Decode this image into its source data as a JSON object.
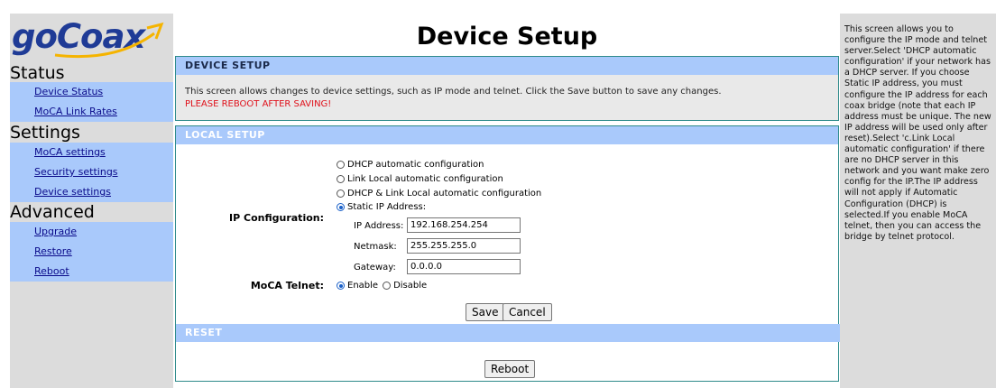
{
  "brand": {
    "logo_text": "goCoax"
  },
  "sidebar": {
    "sections": [
      {
        "title": "Status",
        "items": [
          "Device Status",
          "MoCA Link Rates"
        ]
      },
      {
        "title": "Settings",
        "items": [
          "MoCA settings",
          "Security settings",
          "Device settings"
        ]
      },
      {
        "title": "Advanced",
        "items": [
          "Upgrade",
          "Restore",
          "Reboot"
        ]
      }
    ]
  },
  "page": {
    "title": "Device Setup"
  },
  "device_setup": {
    "heading": "DEVICE SETUP",
    "description": "This screen allows changes to device settings, such as IP mode and telnet. Click the Save button to save any changes.",
    "warning": "PLEASE REBOOT AFTER SAVING!"
  },
  "local_setup": {
    "heading": "LOCAL SETUP",
    "ip_config_label": "IP Configuration:",
    "ip_options": [
      {
        "label": "DHCP automatic configuration",
        "selected": false
      },
      {
        "label": "Link Local automatic configuration",
        "selected": false
      },
      {
        "label": "DHCP & Link Local automatic configuration",
        "selected": false
      },
      {
        "label": "Static IP Address:",
        "selected": true
      }
    ],
    "fields": {
      "ip_address": {
        "label": "IP Address:",
        "value": "192.168.254.254"
      },
      "netmask": {
        "label": "Netmask:",
        "value": "255.255.255.0"
      },
      "gateway": {
        "label": "Gateway:",
        "value": "0.0.0.0"
      }
    },
    "telnet_label": "MoCA Telnet:",
    "telnet_options": [
      {
        "label": "Enable",
        "selected": true
      },
      {
        "label": "Disable",
        "selected": false
      }
    ],
    "save_label": "Save",
    "cancel_label": "Cancel"
  },
  "reset": {
    "heading": "RESET",
    "reboot_label": "Reboot"
  },
  "help": {
    "text": "This screen allows you to configure the IP mode and telnet server.Select 'DHCP automatic configuration' if your network has a DHCP server. If you choose Static IP address, you must configure the IP address for each coax bridge (note that each IP address must be unique. The new IP address will be used only after reset).Select 'c.Link Local automatic configuration' if there are no DHCP server in this network and you want make zero config for the IP.The IP address will not apply if Automatic Configuration (DHCP) is selected.If you enable MoCA telnet, then you can access the bridge by telnet protocol."
  },
  "colors": {
    "nav_bg": "#a9c9fb",
    "sidebar_bg": "#dcdcdc",
    "warning": "#e0101a",
    "panel_border": "#2e8b8b",
    "logo": "#1f3b96"
  }
}
